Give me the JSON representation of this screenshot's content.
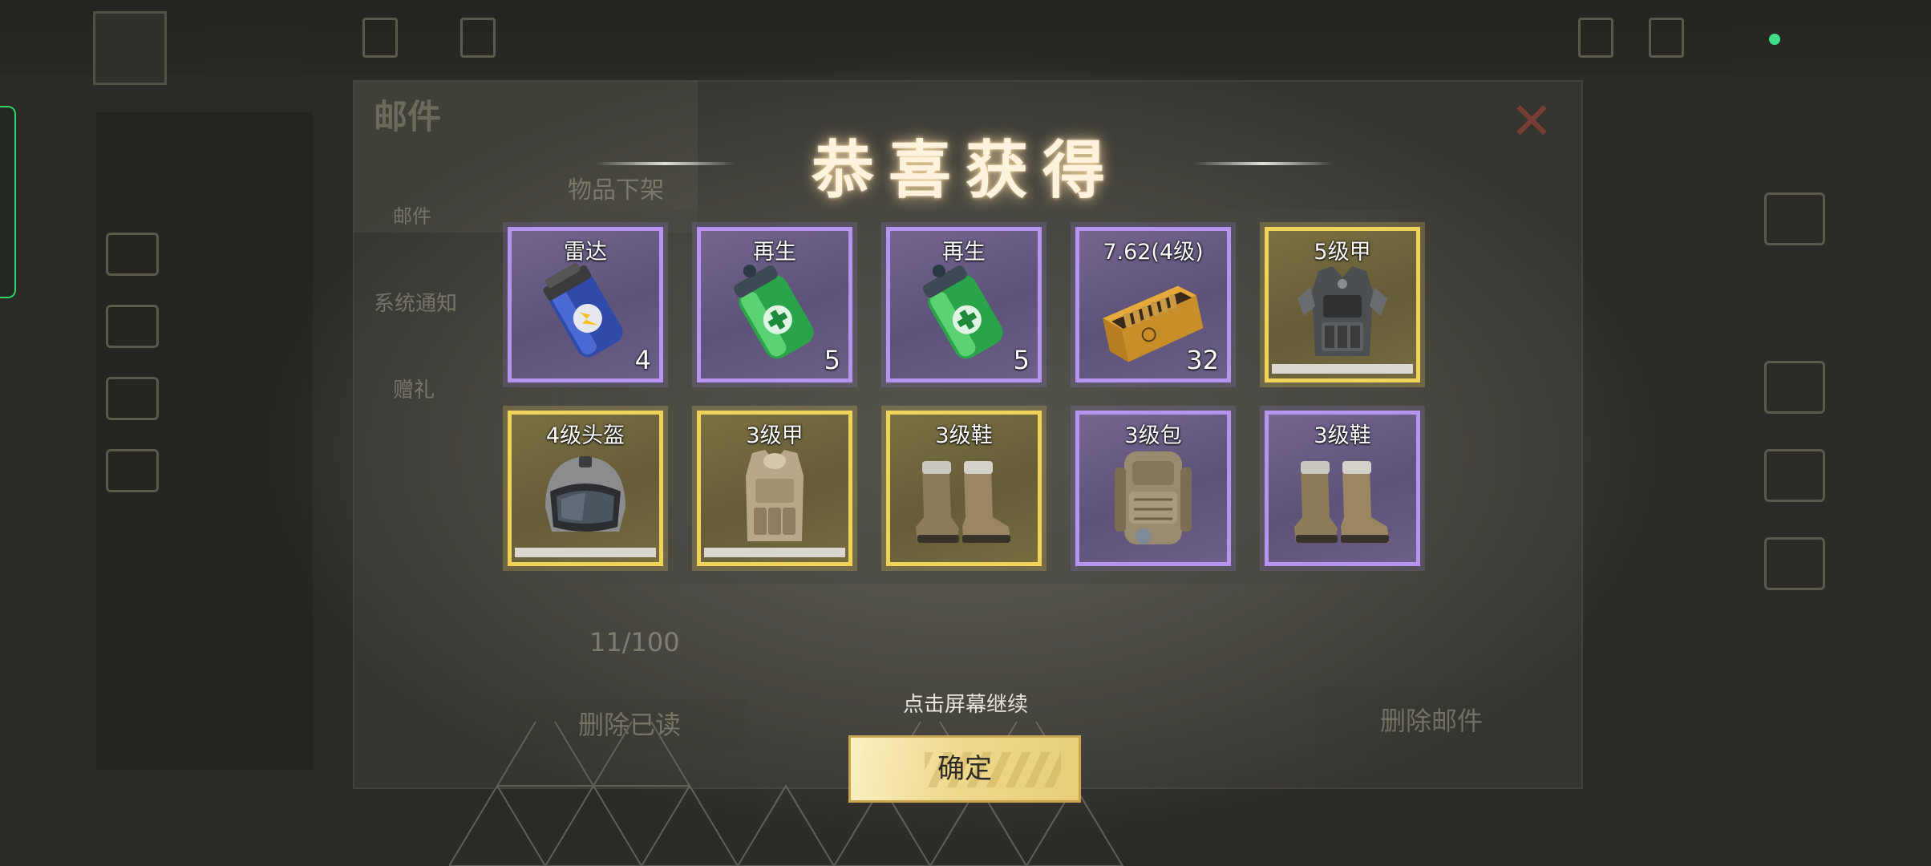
{
  "popup": {
    "title": "恭喜获得",
    "hint": "点击屏幕继续",
    "confirm_label": "确定"
  },
  "rewards": [
    {
      "name": "雷达",
      "count": "4",
      "rarity": "purple",
      "icon": "radar-grenade-icon"
    },
    {
      "name": "再生",
      "count": "5",
      "rarity": "purple",
      "icon": "regen-canister-icon"
    },
    {
      "name": "再生",
      "count": "5",
      "rarity": "purple",
      "icon": "regen-canister-icon"
    },
    {
      "name": "7.62(4级)",
      "count": "32",
      "rarity": "purple",
      "icon": "ammo-box-icon"
    },
    {
      "name": "5级甲",
      "count": "",
      "rarity": "gold",
      "durability": 1.0,
      "icon": "armor-vest-icon"
    },
    {
      "name": "4级头盔",
      "count": "",
      "rarity": "gold",
      "durability": 1.0,
      "icon": "helmet-icon"
    },
    {
      "name": "3级甲",
      "count": "",
      "rarity": "gold",
      "durability": 1.0,
      "icon": "armor-vest-icon"
    },
    {
      "name": "3级鞋",
      "count": "",
      "rarity": "gold",
      "icon": "boots-icon"
    },
    {
      "name": "3级包",
      "count": "",
      "rarity": "purple",
      "icon": "backpack-icon"
    },
    {
      "name": "3级鞋",
      "count": "",
      "rarity": "purple",
      "icon": "boots-icon"
    }
  ],
  "background": {
    "mail_title": "邮件",
    "mail_tab": "邮件",
    "item_offshelf": "物品下架",
    "system_notice": "系统通知",
    "gift": "赠礼",
    "counter": "11/100",
    "delete_read": "删除已读",
    "delete_mail": "删除邮件"
  },
  "colors": {
    "purple_border": "#b894f1",
    "gold_border": "#f1d35a",
    "title_glow": "#ffe0aa",
    "button_gold": "#efd98e"
  }
}
